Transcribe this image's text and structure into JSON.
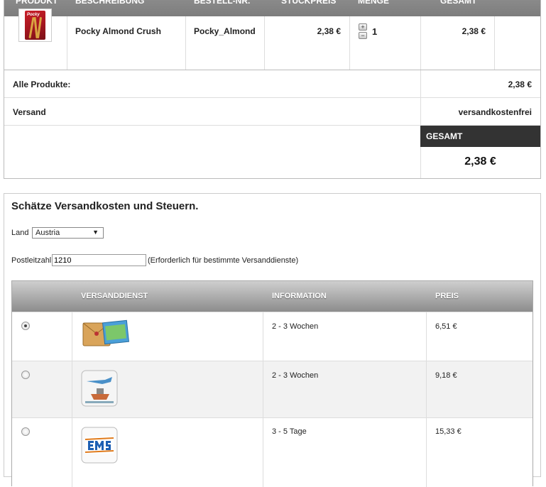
{
  "cart": {
    "headers": [
      "PRODUKT",
      "BESCHREIBUNG",
      "BESTELL-NR.",
      "STÜCKPREIS",
      "MENGE",
      "GESAMT"
    ],
    "item": {
      "image_logo": "Pocky",
      "name": "Pocky Almond Crush",
      "sku": "Pocky_Almond",
      "unit_price": "2,38 €",
      "qty_plus": "+",
      "qty_minus": "−",
      "quantity": "1",
      "total": "2,38 €"
    },
    "all_products_label": "Alle Produkte:",
    "all_products_value": "2,38 €",
    "shipping_label": "Versand",
    "shipping_value": "versandkostenfrei",
    "grand_total_label": "GESAMT",
    "grand_total_value": "2,38 €"
  },
  "estimate": {
    "title": "Schätze Versandkosten und Steuern.",
    "country_label": "Land",
    "country_value": "Austria",
    "zip_label": "Postleitzahl",
    "zip_value": "1210",
    "zip_hint": "(Erforderlich für bestimmte Versanddienste)",
    "headers": {
      "service": "VERSANDDIENST",
      "info": "INFORMATION",
      "price": "PREIS"
    },
    "rows": [
      {
        "icon": "parcel-icon",
        "info": "2 - 3 Wochen",
        "price": "6,51 €",
        "selected": true
      },
      {
        "icon": "airmail-ship-icon",
        "info": "2 - 3 Wochen",
        "price": "9,18 €",
        "selected": false
      },
      {
        "icon": "ems-icon",
        "info": "3 - 5 Tage",
        "price": "15,33 €",
        "selected": false
      }
    ]
  },
  "colors": {
    "header_gray": "#7d7d7d",
    "total_dark": "#333333"
  }
}
